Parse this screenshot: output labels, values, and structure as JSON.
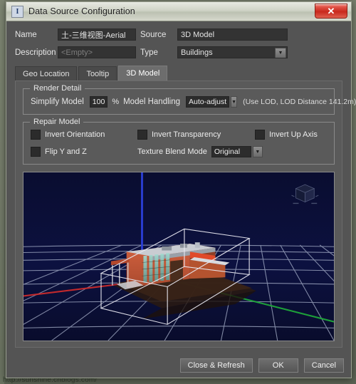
{
  "window": {
    "title": "Data Source Configuration",
    "icon": "app-icon",
    "close_label": "✕"
  },
  "form": {
    "name_label": "Name",
    "name_value": "土-三维视图-Aerial",
    "source_label": "Source",
    "source_value": "3D Model",
    "description_label": "Description",
    "description_placeholder": "<Empty>",
    "description_value": "<Empty>",
    "type_label": "Type",
    "type_value": "Buildings",
    "type_options": [
      "Buildings"
    ]
  },
  "tabs": [
    {
      "label": "Geo Location",
      "active": false
    },
    {
      "label": "Tooltip",
      "active": false
    },
    {
      "label": "3D Model",
      "active": true
    }
  ],
  "render_detail": {
    "group_title": "Render Detail",
    "simplify_label": "Simplify Model",
    "simplify_value": "100",
    "percent_label": "%",
    "handling_label": "Model Handling",
    "handling_value": "Auto-adjust",
    "handling_options": [
      "Auto-adjust"
    ],
    "lod_hint": "(Use LOD, LOD Distance 141.2m)"
  },
  "repair_model": {
    "group_title": "Repair Model",
    "invert_orientation": "Invert Orientation",
    "invert_transparency": "Invert Transparency",
    "invert_up_axis": "Invert Up Axis",
    "flip_y_and_z": "Flip Y and Z",
    "texture_blend_label": "Texture Blend Mode",
    "texture_blend_value": "Original",
    "texture_blend_options": [
      "Original"
    ],
    "checked": false
  },
  "viewport": {
    "name": "3d-model-preview",
    "background_color": "#0b1040",
    "grid_color": "#b9c2d8",
    "axis_x_color": "#cc2b2b",
    "axis_y_color": "#1fa83a",
    "axis_z_color": "#2b3fd8",
    "bbox_color": "#e8e8f0",
    "nav_cube_label": "nav-cube"
  },
  "footer": {
    "close_refresh": "Close & Refresh",
    "ok": "OK",
    "cancel": "Cancel"
  },
  "desktop": {
    "watermark": "http://sunshine.cnblogs.com/"
  }
}
